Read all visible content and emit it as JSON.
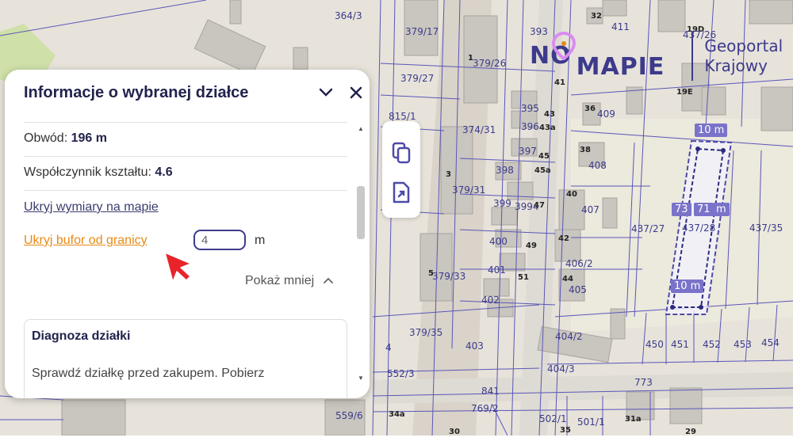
{
  "map": {
    "parcel_labels": [
      "364/3",
      "379/17",
      "379/27",
      "815/1",
      "379/26",
      "379/31",
      "379/33",
      "379/35",
      "552/3",
      "559/6",
      "374/31",
      "393",
      "395",
      "396",
      "397",
      "398",
      "399",
      "3994",
      "400",
      "401",
      "402",
      "403",
      "404/2",
      "404/3",
      "405",
      "406/2",
      "407",
      "408",
      "409",
      "411",
      "32",
      "19D",
      "19E",
      "437/26",
      "437/27",
      "437/28",
      "437/35",
      "450",
      "451",
      "452",
      "453",
      "454",
      "773",
      "841",
      "769/2",
      "502/1",
      "501/1",
      "4"
    ],
    "building_numbers": [
      "1",
      "3",
      "5",
      "36",
      "38",
      "40",
      "42",
      "44",
      "43",
      "43a",
      "45",
      "45a",
      "47",
      "49",
      "51",
      "41",
      "34a",
      "30",
      "35",
      "31a",
      "29"
    ],
    "measure_tags": [
      "10 m",
      "73",
      "71",
      "m",
      "10 m"
    ]
  },
  "logo": {
    "word1": "NO",
    "word2": "MAPIE",
    "line1": "Geoportal",
    "line2": "Krajowy"
  },
  "panel": {
    "title": "Informacje o wybranej działce",
    "collapse_icon": "chevron-down-icon",
    "close_icon": "close-icon",
    "obwod_label": "Obwód: ",
    "obwod_value": "196 m",
    "shape_label": "Współczynnik kształtu: ",
    "shape_value": "4.6",
    "hide_dims_link": "Ukryj wymiary na mapie",
    "hide_buffer_link": "Ukryj bufor od granicy",
    "buffer_value": "4",
    "buffer_unit": "m",
    "show_less": "Pokaż mniej",
    "diagnosis_title": "Diagnoza działki",
    "diagnosis_text": "Sprawdź działkę przed zakupem. Pobierz"
  },
  "toolbar": {
    "copy_icon": "copy-icon",
    "export_icon": "export-icon"
  },
  "colors": {
    "accent": "#3d3a8c",
    "link_orange": "#e68a16",
    "buffer_purple": "#7a73c9",
    "cursor_red": "#e8232a"
  }
}
